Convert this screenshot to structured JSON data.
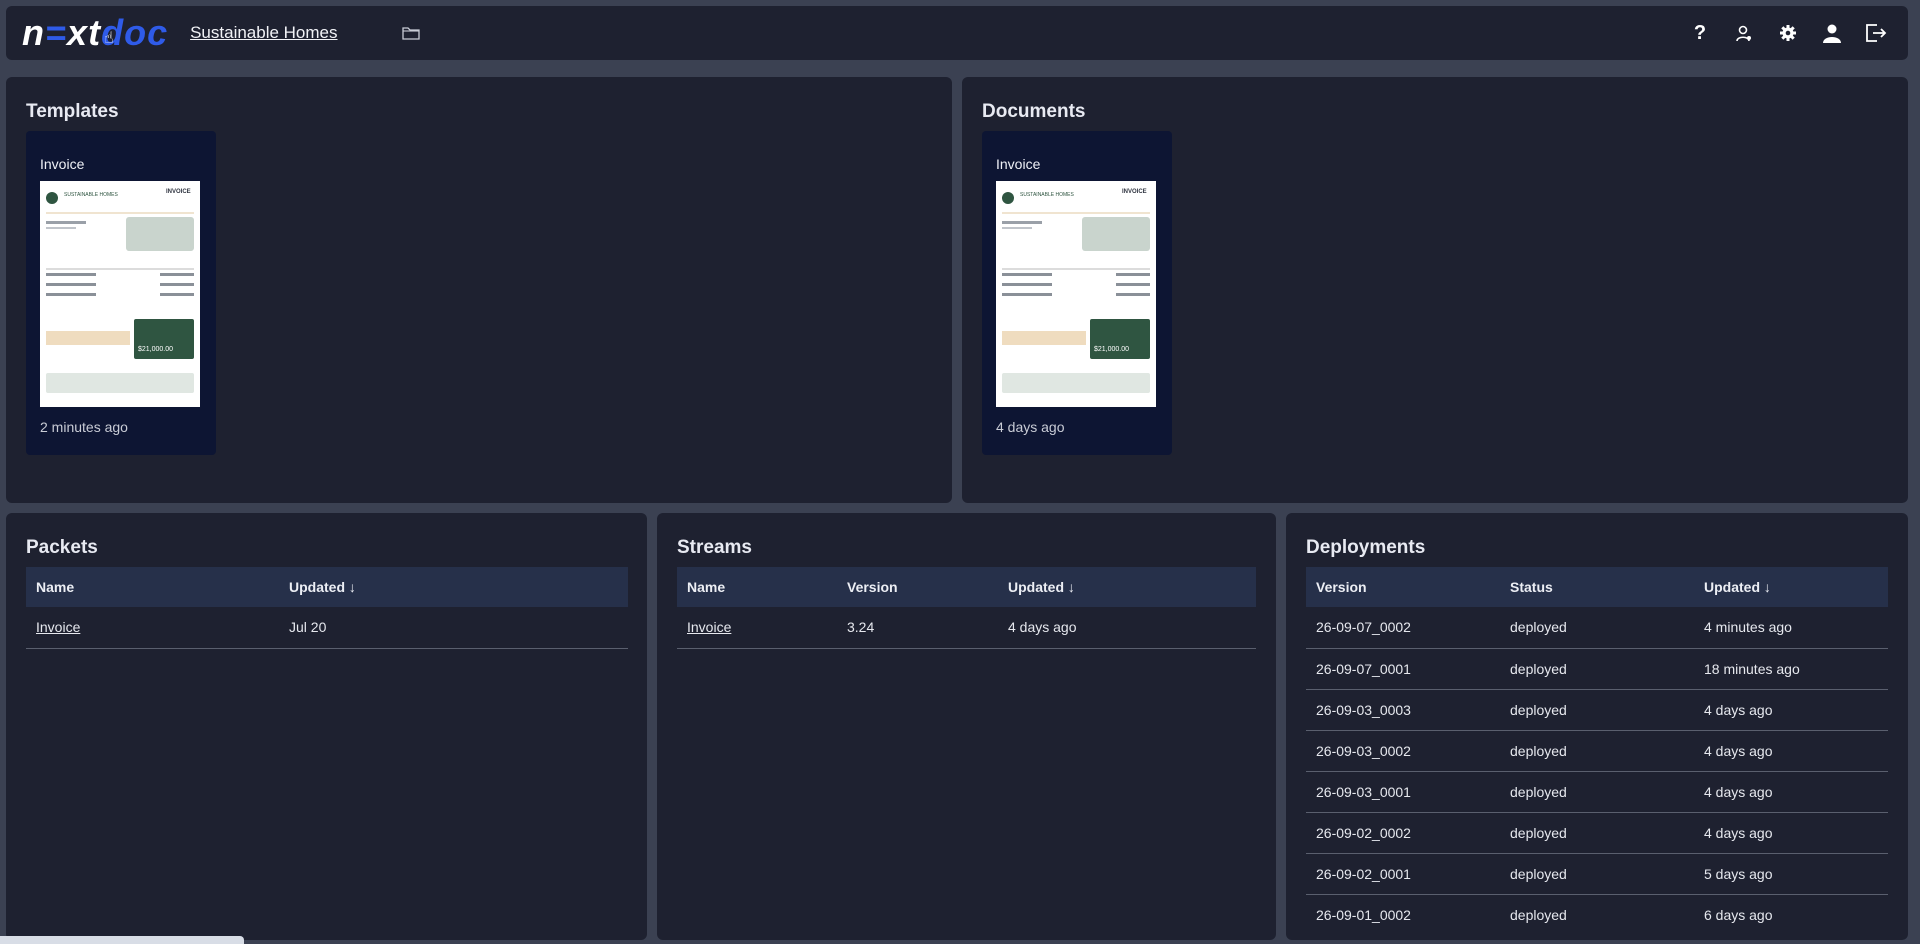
{
  "brand": {
    "logo_parts": [
      "n",
      "=",
      "x",
      "t",
      "d",
      "o",
      "c"
    ]
  },
  "header": {
    "project_name": "Sustainable Homes"
  },
  "templates": {
    "title": "Templates",
    "card": {
      "name": "Invoice",
      "updated": "2 minutes ago"
    }
  },
  "documents": {
    "title": "Documents",
    "card": {
      "name": "Invoice",
      "updated": "4 days ago"
    }
  },
  "thumbnail": {
    "company": "SUSTAINABLE HOMES",
    "heading": "INVOICE",
    "total": "$21,000.00"
  },
  "packets": {
    "title": "Packets",
    "columns": [
      "Name",
      "Updated ↓"
    ],
    "rows": [
      {
        "name": "Invoice",
        "updated": "Jul 20"
      }
    ]
  },
  "streams": {
    "title": "Streams",
    "columns": [
      "Name",
      "Version",
      "Updated ↓"
    ],
    "rows": [
      {
        "name": "Invoice",
        "version": "3.24",
        "updated": "4 days ago"
      }
    ]
  },
  "deployments": {
    "title": "Deployments",
    "columns": [
      "Version",
      "Status",
      "Updated ↓"
    ],
    "rows": [
      {
        "version": "26-09-07_0002",
        "status": "deployed",
        "updated": "4 minutes ago"
      },
      {
        "version": "26-09-07_0001",
        "status": "deployed",
        "updated": "18 minutes ago"
      },
      {
        "version": "26-09-03_0003",
        "status": "deployed",
        "updated": "4 days ago"
      },
      {
        "version": "26-09-03_0002",
        "status": "deployed",
        "updated": "4 days ago"
      },
      {
        "version": "26-09-03_0001",
        "status": "deployed",
        "updated": "4 days ago"
      },
      {
        "version": "26-09-02_0002",
        "status": "deployed",
        "updated": "4 days ago"
      },
      {
        "version": "26-09-02_0001",
        "status": "deployed",
        "updated": "5 days ago"
      },
      {
        "version": "26-09-01_0002",
        "status": "deployed",
        "updated": "6 days ago"
      }
    ]
  },
  "icons": [
    "help-icon",
    "user-admin-icon",
    "gear-icon",
    "account-icon",
    "logout-icon",
    "folder-icon"
  ],
  "colors": {
    "background": "#3b4152",
    "panel": "#1e2130",
    "card": "#0d1533",
    "table_header": "#26304a",
    "brand_blue": "#2f5be8"
  }
}
